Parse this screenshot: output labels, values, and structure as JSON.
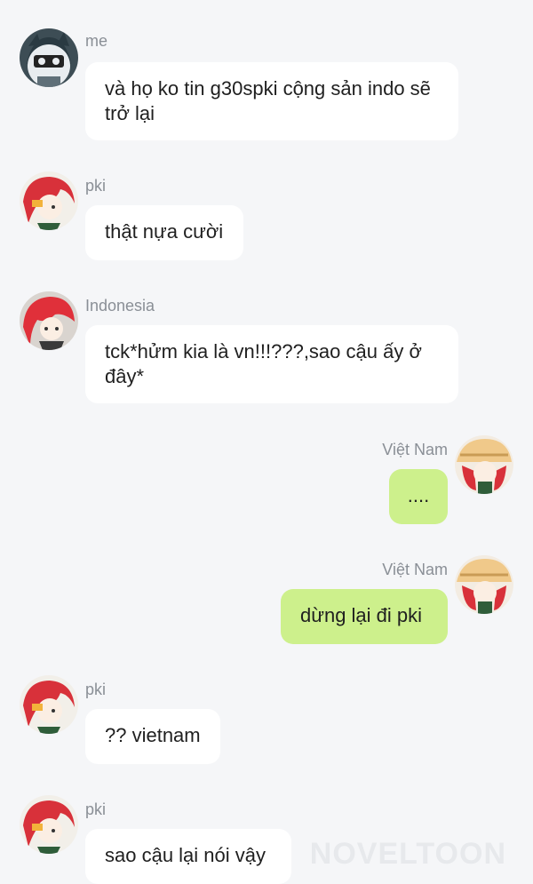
{
  "messages": [
    {
      "sender": "me",
      "text": "và họ ko tin g30spki cộng sản indo sẽ trở lại",
      "avatar": "robot-avatar-icon"
    },
    {
      "sender": "pki",
      "text": "thật nựa cười",
      "avatar": "red-hair-avatar-icon"
    },
    {
      "sender": "Indonesia",
      "text": "tck*hửm kia là vn!!!???,sao cậu ấy ở đây*",
      "avatar": "red-hair-avatar-icon"
    },
    {
      "sender": "Việt Nam",
      "text": "....",
      "avatar": "straw-hat-avatar-icon"
    },
    {
      "sender": "Việt Nam",
      "text": "dừng lại đi pki",
      "avatar": "straw-hat-avatar-icon"
    },
    {
      "sender": "pki",
      "text": "?? vietnam",
      "avatar": "red-hair-avatar-icon"
    },
    {
      "sender": "pki",
      "text": "sao cậu lại nói vậy",
      "avatar": "red-hair-avatar-icon"
    }
  ],
  "watermark": "NOVELTOON",
  "colors": {
    "background": "#f5f6f8",
    "bubble_left": "#ffffff",
    "bubble_right": "#cdf08c",
    "name_text": "#8a8f96",
    "message_text": "#1f1f1f"
  }
}
